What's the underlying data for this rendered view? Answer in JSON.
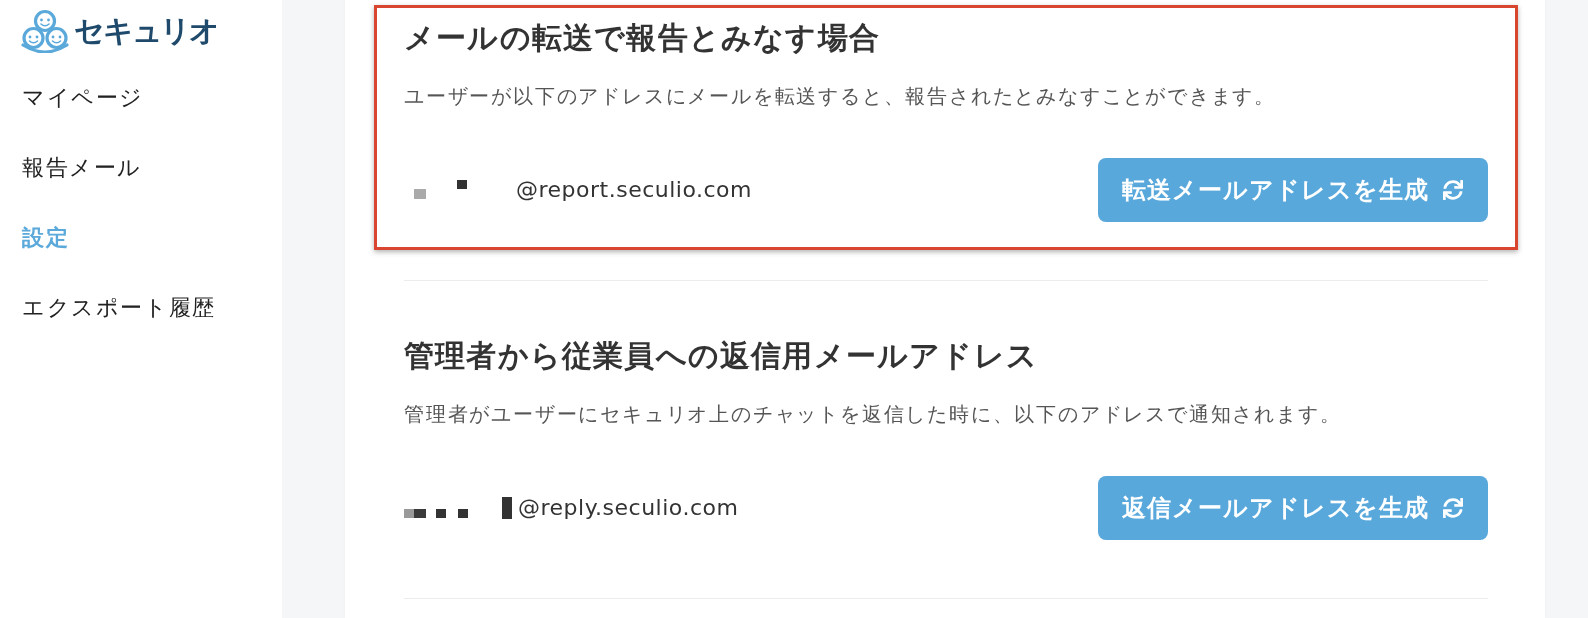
{
  "sidebar": {
    "logo": {
      "text": "セキュリオ"
    },
    "items": [
      {
        "label": "マイページ",
        "selected": false
      },
      {
        "label": "報告メール",
        "selected": false
      },
      {
        "label": "設定",
        "selected": true
      },
      {
        "label": "エクスポート履歴",
        "selected": false
      }
    ]
  },
  "sections": [
    {
      "title": "メールの転送で報告とみなす場合",
      "description": "ユーザーが以下のアドレスにメールを転送すると、報告されたとみなすことができます。",
      "highlighted": true,
      "address": {
        "masked": true,
        "value": "@report.seculio.com"
      },
      "button": {
        "label": "転送メールアドレスを生成"
      }
    },
    {
      "title": "管理者から従業員への返信用メールアドレス",
      "description": "管理者がユーザーにセキュリオ上のチャットを返信した時に、以下のアドレスで通知されます。",
      "highlighted": false,
      "address": {
        "masked": true,
        "value": "@reply.seculio.com"
      },
      "button": {
        "label": "返信メールアドレスを生成"
      }
    }
  ]
}
